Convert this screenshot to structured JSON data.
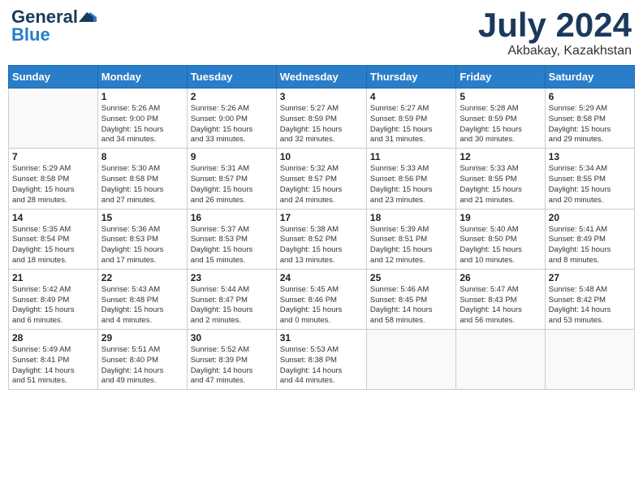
{
  "header": {
    "logo_general": "General",
    "logo_blue": "Blue",
    "month_year": "July 2024",
    "location": "Akbakay, Kazakhstan"
  },
  "days_of_week": [
    "Sunday",
    "Monday",
    "Tuesday",
    "Wednesday",
    "Thursday",
    "Friday",
    "Saturday"
  ],
  "weeks": [
    [
      {
        "day": "",
        "content": ""
      },
      {
        "day": "1",
        "content": "Sunrise: 5:26 AM\nSunset: 9:00 PM\nDaylight: 15 hours\nand 34 minutes."
      },
      {
        "day": "2",
        "content": "Sunrise: 5:26 AM\nSunset: 9:00 PM\nDaylight: 15 hours\nand 33 minutes."
      },
      {
        "day": "3",
        "content": "Sunrise: 5:27 AM\nSunset: 8:59 PM\nDaylight: 15 hours\nand 32 minutes."
      },
      {
        "day": "4",
        "content": "Sunrise: 5:27 AM\nSunset: 8:59 PM\nDaylight: 15 hours\nand 31 minutes."
      },
      {
        "day": "5",
        "content": "Sunrise: 5:28 AM\nSunset: 8:59 PM\nDaylight: 15 hours\nand 30 minutes."
      },
      {
        "day": "6",
        "content": "Sunrise: 5:29 AM\nSunset: 8:58 PM\nDaylight: 15 hours\nand 29 minutes."
      }
    ],
    [
      {
        "day": "7",
        "content": "Sunrise: 5:29 AM\nSunset: 8:58 PM\nDaylight: 15 hours\nand 28 minutes."
      },
      {
        "day": "8",
        "content": "Sunrise: 5:30 AM\nSunset: 8:58 PM\nDaylight: 15 hours\nand 27 minutes."
      },
      {
        "day": "9",
        "content": "Sunrise: 5:31 AM\nSunset: 8:57 PM\nDaylight: 15 hours\nand 26 minutes."
      },
      {
        "day": "10",
        "content": "Sunrise: 5:32 AM\nSunset: 8:57 PM\nDaylight: 15 hours\nand 24 minutes."
      },
      {
        "day": "11",
        "content": "Sunrise: 5:33 AM\nSunset: 8:56 PM\nDaylight: 15 hours\nand 23 minutes."
      },
      {
        "day": "12",
        "content": "Sunrise: 5:33 AM\nSunset: 8:55 PM\nDaylight: 15 hours\nand 21 minutes."
      },
      {
        "day": "13",
        "content": "Sunrise: 5:34 AM\nSunset: 8:55 PM\nDaylight: 15 hours\nand 20 minutes."
      }
    ],
    [
      {
        "day": "14",
        "content": "Sunrise: 5:35 AM\nSunset: 8:54 PM\nDaylight: 15 hours\nand 18 minutes."
      },
      {
        "day": "15",
        "content": "Sunrise: 5:36 AM\nSunset: 8:53 PM\nDaylight: 15 hours\nand 17 minutes."
      },
      {
        "day": "16",
        "content": "Sunrise: 5:37 AM\nSunset: 8:53 PM\nDaylight: 15 hours\nand 15 minutes."
      },
      {
        "day": "17",
        "content": "Sunrise: 5:38 AM\nSunset: 8:52 PM\nDaylight: 15 hours\nand 13 minutes."
      },
      {
        "day": "18",
        "content": "Sunrise: 5:39 AM\nSunset: 8:51 PM\nDaylight: 15 hours\nand 12 minutes."
      },
      {
        "day": "19",
        "content": "Sunrise: 5:40 AM\nSunset: 8:50 PM\nDaylight: 15 hours\nand 10 minutes."
      },
      {
        "day": "20",
        "content": "Sunrise: 5:41 AM\nSunset: 8:49 PM\nDaylight: 15 hours\nand 8 minutes."
      }
    ],
    [
      {
        "day": "21",
        "content": "Sunrise: 5:42 AM\nSunset: 8:49 PM\nDaylight: 15 hours\nand 6 minutes."
      },
      {
        "day": "22",
        "content": "Sunrise: 5:43 AM\nSunset: 8:48 PM\nDaylight: 15 hours\nand 4 minutes."
      },
      {
        "day": "23",
        "content": "Sunrise: 5:44 AM\nSunset: 8:47 PM\nDaylight: 15 hours\nand 2 minutes."
      },
      {
        "day": "24",
        "content": "Sunrise: 5:45 AM\nSunset: 8:46 PM\nDaylight: 15 hours\nand 0 minutes."
      },
      {
        "day": "25",
        "content": "Sunrise: 5:46 AM\nSunset: 8:45 PM\nDaylight: 14 hours\nand 58 minutes."
      },
      {
        "day": "26",
        "content": "Sunrise: 5:47 AM\nSunset: 8:43 PM\nDaylight: 14 hours\nand 56 minutes."
      },
      {
        "day": "27",
        "content": "Sunrise: 5:48 AM\nSunset: 8:42 PM\nDaylight: 14 hours\nand 53 minutes."
      }
    ],
    [
      {
        "day": "28",
        "content": "Sunrise: 5:49 AM\nSunset: 8:41 PM\nDaylight: 14 hours\nand 51 minutes."
      },
      {
        "day": "29",
        "content": "Sunrise: 5:51 AM\nSunset: 8:40 PM\nDaylight: 14 hours\nand 49 minutes."
      },
      {
        "day": "30",
        "content": "Sunrise: 5:52 AM\nSunset: 8:39 PM\nDaylight: 14 hours\nand 47 minutes."
      },
      {
        "day": "31",
        "content": "Sunrise: 5:53 AM\nSunset: 8:38 PM\nDaylight: 14 hours\nand 44 minutes."
      },
      {
        "day": "",
        "content": ""
      },
      {
        "day": "",
        "content": ""
      },
      {
        "day": "",
        "content": ""
      }
    ]
  ]
}
